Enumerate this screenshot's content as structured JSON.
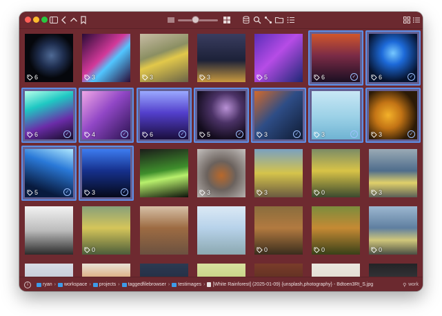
{
  "colors": {
    "window_bg": "#6e2a30",
    "selection": "#5e8fe6",
    "folder": "#3d9be9"
  },
  "toolbar": {
    "icons": [
      "sidebar-icon",
      "back-chevron-icon",
      "up-chevron-icon",
      "bookmark-icon",
      "list-density-icon",
      "size-slider",
      "grid-density-icon",
      "database-icon",
      "search-icon",
      "graph-icon",
      "folder-icon",
      "list-filter-icon",
      "grid-view-icon",
      "list-view-icon"
    ]
  },
  "grid": {
    "cells": [
      {
        "tags": "6",
        "selected": false
      },
      {
        "tags": "3",
        "selected": false
      },
      {
        "tags": "3",
        "selected": false
      },
      {
        "tags": "3",
        "selected": false
      },
      {
        "tags": "5",
        "selected": false
      },
      {
        "tags": "6",
        "selected": true
      },
      {
        "tags": "6",
        "selected": true
      },
      {
        "tags": "6",
        "selected": true
      },
      {
        "tags": "4",
        "selected": true
      },
      {
        "tags": "6",
        "selected": true
      },
      {
        "tags": "5",
        "selected": true
      },
      {
        "tags": "3",
        "selected": true
      },
      {
        "tags": "3",
        "selected": true
      },
      {
        "tags": "3",
        "selected": true
      },
      {
        "tags": "5",
        "selected": true
      },
      {
        "tags": "3",
        "selected": true
      },
      {
        "tags": "",
        "selected": false
      },
      {
        "tags": "3",
        "selected": false
      },
      {
        "tags": "3",
        "selected": false
      },
      {
        "tags": "0",
        "selected": false
      },
      {
        "tags": "3",
        "selected": false
      },
      {
        "tags": "",
        "selected": false
      },
      {
        "tags": "0",
        "selected": false
      },
      {
        "tags": "",
        "selected": false
      },
      {
        "tags": "",
        "selected": false
      },
      {
        "tags": "0",
        "selected": false
      },
      {
        "tags": "0",
        "selected": false
      },
      {
        "tags": "0",
        "selected": false
      },
      {
        "tags": "",
        "selected": false
      },
      {
        "tags": "",
        "selected": false
      },
      {
        "tags": "",
        "selected": false
      },
      {
        "tags": "",
        "selected": false
      },
      {
        "tags": "",
        "selected": false
      },
      {
        "tags": "",
        "selected": false
      },
      {
        "tags": "",
        "selected": false
      }
    ]
  },
  "statusbar": {
    "crumbs": [
      "ryan",
      "workspace",
      "projects",
      "taggedfilebrowser",
      "testimages"
    ],
    "file": "[White Rainforest] (2025-01-09) {unsplash,photography} - Bdtoen3Rt_S.jpg",
    "workspace": "work"
  }
}
